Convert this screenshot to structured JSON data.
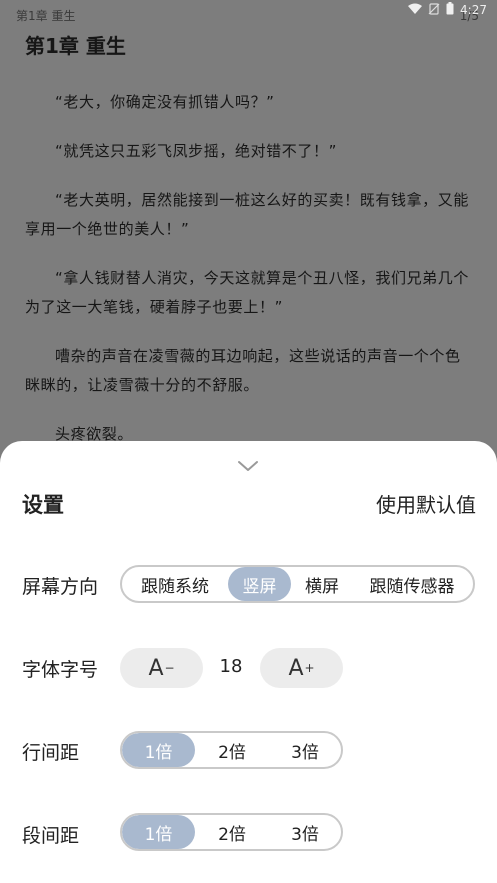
{
  "status": {
    "chapter": "第1章 重生",
    "page": "1/5",
    "time": "4:27"
  },
  "reader": {
    "title": "第1章 重生",
    "paragraphs": [
      "“老大，你确定没有抓错人吗？”",
      "“就凭这只五彩飞凤步摇，绝对错不了！”",
      "“老大英明，居然能接到一桩这么好的买卖！既有钱拿，又能享用一个绝世的美人！”",
      "“拿人钱财替人消灾，今天这就算是个丑八怪，我们兄弟几个为了这一大笔钱，硬着脖子也要上！”",
      "嘈杂的声音在凌雪薇的耳边响起，这些说话的声音一个个色眯眯的，让凌雪薇十分的不舒服。",
      "头疼欲裂。"
    ]
  },
  "settings": {
    "title": "设置",
    "use_default": "使用默认值",
    "orientation": {
      "label": "屏幕方向",
      "options": [
        "跟随系统",
        "竖屏",
        "横屏",
        "跟随传感器"
      ],
      "selected": "竖屏"
    },
    "font": {
      "label": "字体字号",
      "decrease": "A",
      "decrease_sup": "−",
      "increase": "A",
      "increase_sup": "+",
      "value": "18"
    },
    "line_spacing": {
      "label": "行间距",
      "options": [
        "1倍",
        "2倍",
        "3倍"
      ],
      "selected": "1倍"
    },
    "para_spacing": {
      "label": "段间距",
      "options": [
        "1倍",
        "2倍",
        "3倍"
      ],
      "selected": "1倍"
    }
  },
  "colors": {
    "accent": "#a9b9cf",
    "overlay": "#7d7d7d",
    "sheet": "#ffffff"
  }
}
